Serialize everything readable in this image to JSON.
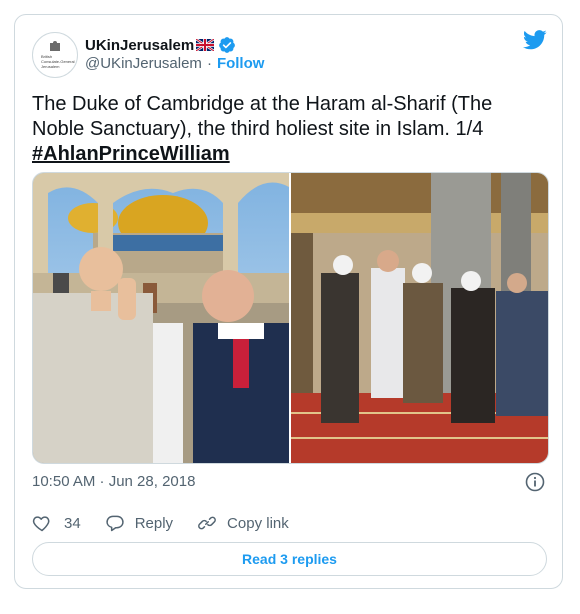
{
  "author": {
    "display_name": "UKinJerusalem",
    "handle": "@UKinJerusalem",
    "follow_label": "Follow",
    "avatar_text": [
      "British",
      "Consulate-General",
      "Jerusalem"
    ],
    "verified": true
  },
  "tweet": {
    "text": "The Duke of Cambridge at the Haram al-Sharif (The Noble Sanctuary), the third holiest site in Islam. 1/4",
    "hashtag": "#AhlanPrinceWilliam",
    "timestamp": "10:50 AM · Jun 28, 2018"
  },
  "actions": {
    "likes": "34",
    "reply_label": "Reply",
    "copy_link_label": "Copy link"
  },
  "replies_button": "Read 3 replies",
  "icons": {
    "brand": "twitter-bird-icon",
    "verified": "verified-badge-icon",
    "info": "info-icon",
    "like": "heart-icon",
    "reply": "reply-bubble-icon",
    "link": "link-icon"
  },
  "colors": {
    "accent": "#1d9bf0",
    "text": "#0f1419",
    "muted": "#536471",
    "border": "#cfd9de"
  }
}
